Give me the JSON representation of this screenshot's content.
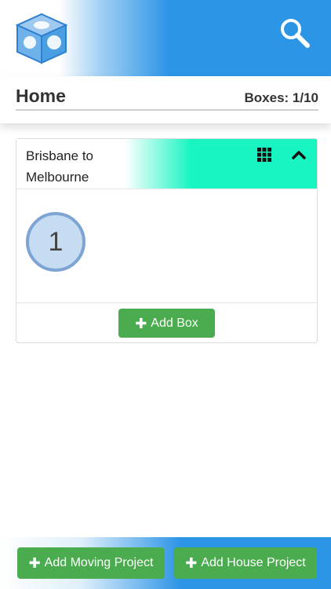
{
  "header": {
    "logo_icon": "cube-logo-icon",
    "search_icon": "search-icon"
  },
  "subheader": {
    "title": "Home",
    "box_count": "Boxes: 1/10"
  },
  "project": {
    "title": "Brisbane to Melbourne",
    "grid_icon": "grid-icon",
    "collapse_icon": "chevron-up-icon",
    "boxes": [
      {
        "number": "1"
      }
    ],
    "add_box_label": "Add Box"
  },
  "footer": {
    "add_moving_label": "Add Moving Project",
    "add_house_label": "Add House Project"
  },
  "colors": {
    "header_blue": "#2d95e6",
    "project_header_accent": "#19f5c2",
    "button_green": "#4aac4f",
    "box_fill": "#c6dcf2",
    "box_border": "#7ea4d4"
  }
}
